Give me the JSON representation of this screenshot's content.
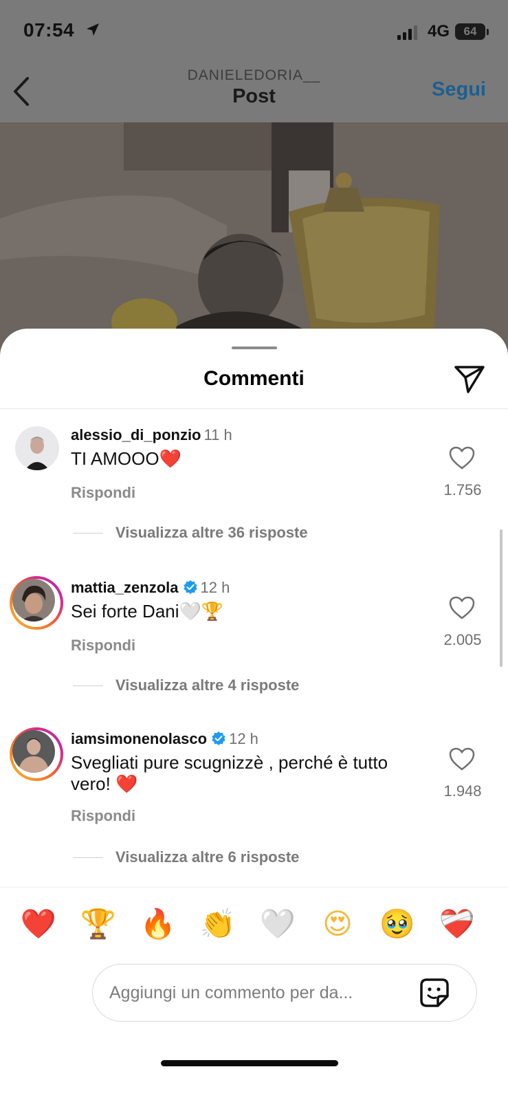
{
  "status_bar": {
    "time": "07:54",
    "network": "4G",
    "battery": "64"
  },
  "header": {
    "username": "DANIELEDORIA__",
    "title": "Post",
    "follow_label": "Segui"
  },
  "sheet": {
    "title": "Commenti"
  },
  "comments": [
    {
      "username": "alessio_di_ponzio",
      "verified": false,
      "age": "11 h",
      "text": "TI AMOOO",
      "emoji": "❤️",
      "reply_label": "Rispondi",
      "likes": "1.756",
      "more_replies": "Visualizza altre 36 risposte"
    },
    {
      "username": "mattia_zenzola",
      "verified": true,
      "age": "12 h",
      "text": "Sei forte Dani",
      "emoji": "🤍🏆",
      "reply_label": "Rispondi",
      "likes": "2.005",
      "more_replies": "Visualizza altre 4 risposte"
    },
    {
      "username": "iamsimonenolasco",
      "verified": true,
      "age": "12 h",
      "text": "Svegliati pure scugnizzè , perché è tutto vero!",
      "emoji": "❤️",
      "reply_label": "Rispondi",
      "likes": "1.948",
      "more_replies": "Visualizza altre 6 risposte"
    }
  ],
  "quick_reactions": [
    "❤️",
    "🏆",
    "🔥",
    "👏",
    "🤍",
    "😍",
    "🥹",
    "❤️‍🩹"
  ],
  "composer": {
    "placeholder": "Aggiungi un commento per da..."
  },
  "colors": {
    "accent": "#0095f6",
    "verified": "#1d9bf0",
    "heart": "#e02424"
  }
}
